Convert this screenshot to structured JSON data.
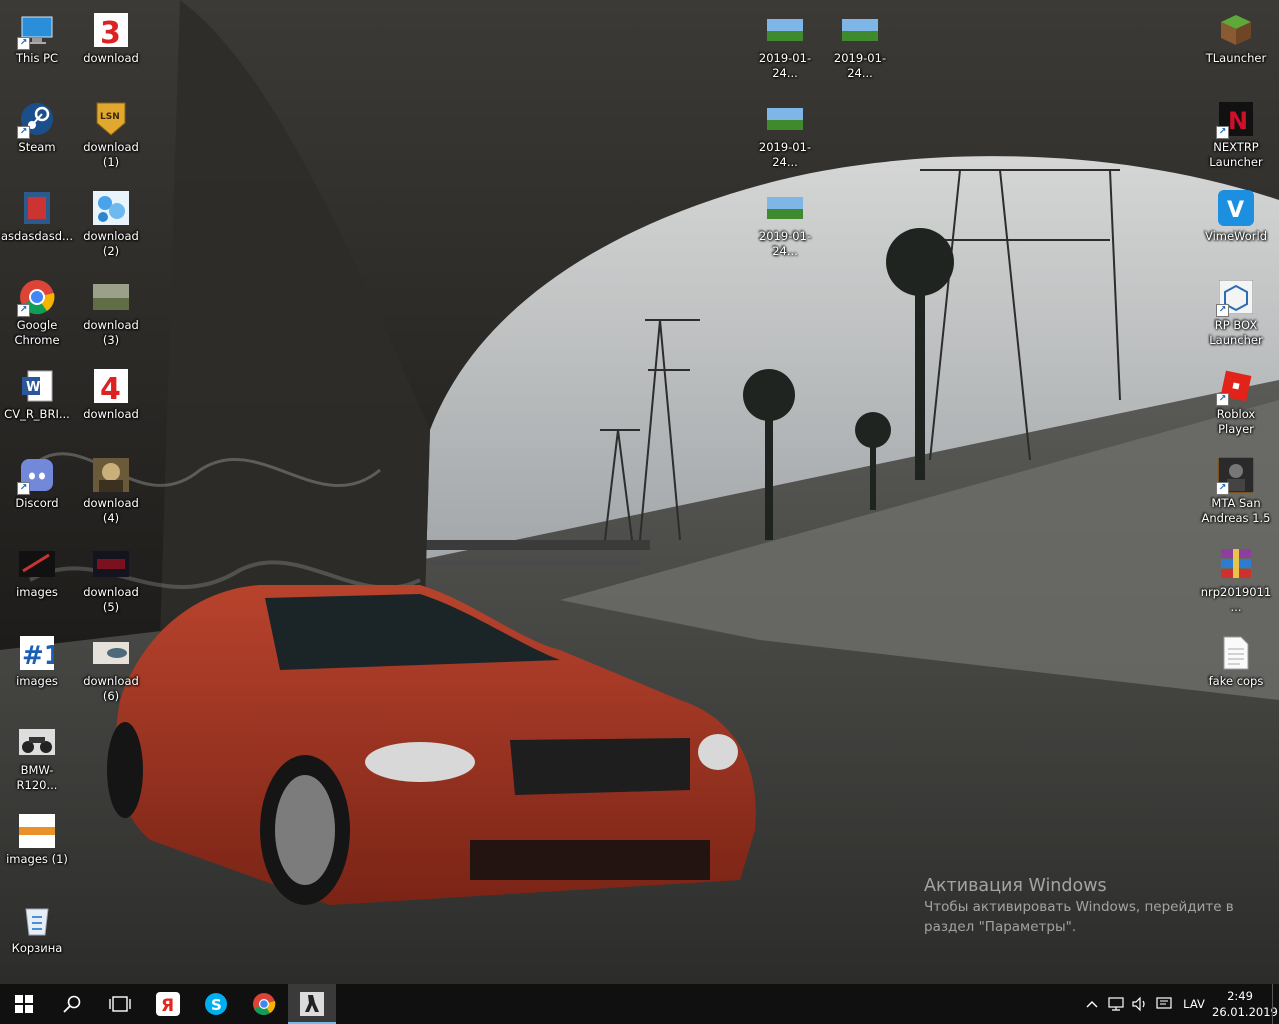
{
  "desktop": {
    "left_column": [
      {
        "label": "This PC",
        "icon": "this-pc-icon"
      },
      {
        "label": "Steam",
        "icon": "steam-icon"
      },
      {
        "label": "asdasdasd...",
        "icon": "document-shortcut-icon"
      },
      {
        "label": "Google Chrome",
        "icon": "chrome-icon"
      },
      {
        "label": "CV_R_BRI...",
        "icon": "word-icon"
      },
      {
        "label": "Discord",
        "icon": "discord-icon"
      },
      {
        "label": "images",
        "icon": "image-file-icon"
      },
      {
        "label": "images",
        "icon": "image-file-icon"
      },
      {
        "label": "BMW-R120...",
        "icon": "image-file-icon"
      },
      {
        "label": "images (1)",
        "icon": "image-file-icon"
      },
      {
        "label": "Корзина",
        "icon": "recycle-bin-icon"
      }
    ],
    "second_column": [
      {
        "label": "download",
        "icon": "image-file-icon"
      },
      {
        "label": "download (1)",
        "icon": "image-file-icon"
      },
      {
        "label": "download (2)",
        "icon": "image-file-icon"
      },
      {
        "label": "download (3)",
        "icon": "image-file-icon"
      },
      {
        "label": "download",
        "icon": "image-file-icon"
      },
      {
        "label": "download (4)",
        "icon": "image-file-icon"
      },
      {
        "label": "download (5)",
        "icon": "image-file-icon"
      },
      {
        "label": "download (6)",
        "icon": "image-file-icon"
      }
    ],
    "middle_icons": [
      {
        "label": "2019-01-24...",
        "icon": "screenshot-icon"
      },
      {
        "label": "2019-01-24...",
        "icon": "screenshot-icon"
      },
      {
        "label": "2019-01-24...",
        "icon": "screenshot-icon"
      },
      {
        "label": "2019-01-24...",
        "icon": "screenshot-icon"
      }
    ],
    "right_column": [
      {
        "label": "TLauncher",
        "icon": "minecraft-block-icon"
      },
      {
        "label": "NEXTRP Launcher",
        "icon": "nextrp-icon"
      },
      {
        "label": "VimeWorld",
        "icon": "vimeworld-icon"
      },
      {
        "label": "RP BOX Launcher",
        "icon": "rpbox-icon"
      },
      {
        "label": "Roblox Player",
        "icon": "roblox-icon"
      },
      {
        "label": "MTA San Andreas 1.5",
        "icon": "mta-icon"
      },
      {
        "label": "nrp2019011...",
        "icon": "winrar-icon"
      },
      {
        "label": "fake cops",
        "icon": "text-file-icon"
      }
    ]
  },
  "activation": {
    "title": "Активация Windows",
    "line1": "Чтобы активировать Windows, перейдите в",
    "line2": "раздел \"Параметры\"."
  },
  "taskbar": {
    "pinned": [
      "start-icon",
      "search-icon",
      "task-view-icon",
      "yandex-browser-icon",
      "skype-icon",
      "chrome-icon",
      "counter-strike-icon"
    ],
    "tray": {
      "language": "LAV",
      "time": "2:49",
      "date": "26.01.2019"
    }
  }
}
